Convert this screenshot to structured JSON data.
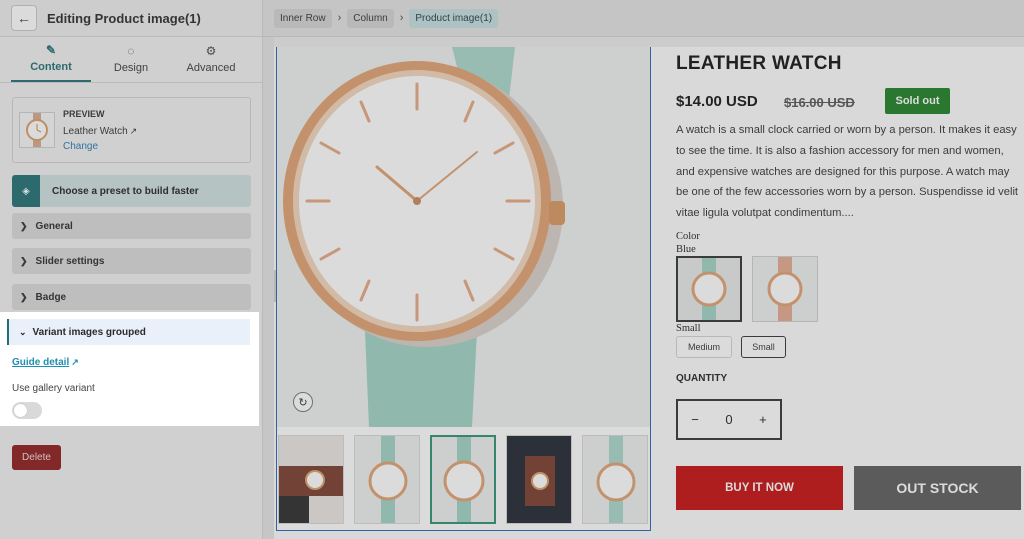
{
  "panel": {
    "title": "Editing Product image(1)",
    "back_icon": "arrow-left-icon",
    "tabs": [
      {
        "label": "Content",
        "icon": "pencil-icon",
        "active": true
      },
      {
        "label": "Design",
        "icon": "palette-icon",
        "active": false
      },
      {
        "label": "Advanced",
        "icon": "gear-icon",
        "active": false
      }
    ],
    "preview": {
      "label": "PREVIEW",
      "product_name": "Leather Watch",
      "change_link": "Change"
    },
    "preset_text": "Choose a preset to build faster",
    "sections": [
      "General",
      "Slider settings",
      "Badge"
    ],
    "variant_section": {
      "title": "Variant images grouped",
      "guide_link": "Guide detail",
      "gallery_label": "Use gallery variant",
      "gallery_enabled": false
    },
    "delete_label": "Delete"
  },
  "breadcrumb": [
    "Inner Row",
    "Column",
    "Product image(1)"
  ],
  "product": {
    "title": "LEATHER WATCH",
    "price": "$14.00 USD",
    "original_price": "$16.00 USD",
    "sold_out": "Sold out",
    "description": "A watch is a small clock carried or worn by a person. It makes it easy to see the time. It is also a fashion accessory for men and women, and expensive watches are designed for this purpose. A watch may be one of the few accessories worn by a person. Suspendisse id velit vitae ligula volutpat condimentum....",
    "color_label": "Color",
    "color_value": "Blue",
    "size_label": "Small",
    "sizes": [
      "Medium",
      "Small"
    ],
    "selected_size": "Small",
    "quantity_label": "QUANTITY",
    "quantity": "0",
    "buy_now": "BUY IT NOW",
    "out_stock": "OUT STOCK"
  },
  "colors": {
    "accent": "#1f6f74",
    "buy": "#c70d0d",
    "sold_out": "#1d7f24",
    "out_stock": "#5c5c5c",
    "delete": "#8f1a1a"
  }
}
